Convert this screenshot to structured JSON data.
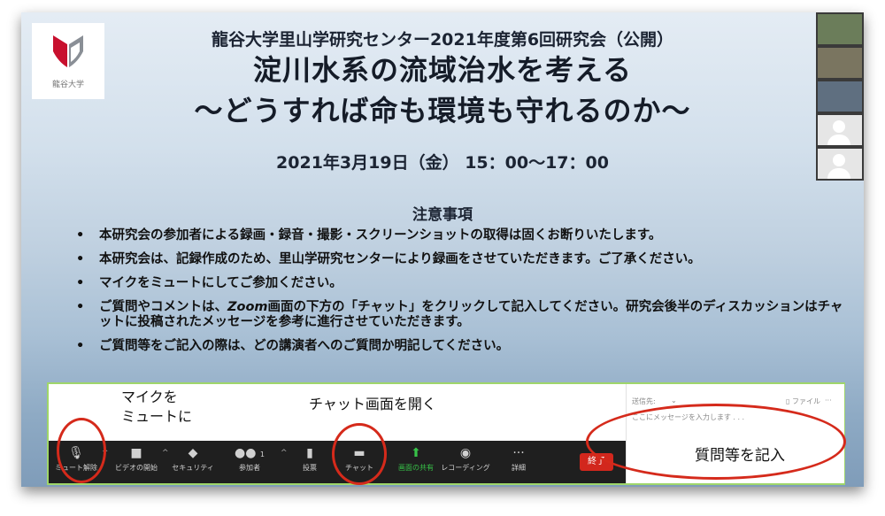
{
  "slide": {
    "logo": {
      "text": "龍谷大学"
    },
    "header": {
      "line1": "龍谷大学里山学研究センター2021年度第6回研究会（公開）",
      "line2": "淀川水系の流域治水を考える",
      "line3": "〜どうすれば命も環境も守れるのか〜"
    },
    "date": "2021年3月19日（金） 15：00〜17：00",
    "notes_title": "注意事項",
    "bullets": [
      "本研究会の参加者による録画・録音・撮影・スクリーンショットの取得は固くお断りいたします。",
      "本研究会は、記録作成のため、里山学研究センターにより録画をさせていただきます。ご了承ください。",
      "マイクをミュートにしてご参加ください。",
      "ご質問等をご記入の際は、どの講演者へのご質問か明記してください。"
    ],
    "bullet4": {
      "part1": "ご質問やコメントは、",
      "zoom": "Zoom",
      "part2": "画面の下方の「チャット」をクリックして記入してください。研究会後半のディスカッションはチャットに投稿されたメッセージを参考に進行させていただきます。"
    }
  },
  "panel": {
    "mute_label_1": "マイクを",
    "mute_label_2": "ミュートに",
    "chat_label": "チャット画面を開く",
    "question_label": "質問等を記入",
    "toolbar": {
      "mute": "ミュート解除",
      "video": "ビデオの開始",
      "security": "セキュリティ",
      "participants": "参加者",
      "participants_count": "1",
      "poll": "投票",
      "chat": "チャット",
      "share": "画面の共有",
      "record": "レコーディング",
      "more": "詳細",
      "end": "終了"
    },
    "chat_box": {
      "to": "送信先:",
      "file": "ファイル",
      "placeholder": "ここにメッセージを入力します . . ."
    }
  },
  "colors": {
    "annotation_red": "#d52a1b",
    "share_green": "#37c248",
    "end_red": "#d2271d"
  }
}
